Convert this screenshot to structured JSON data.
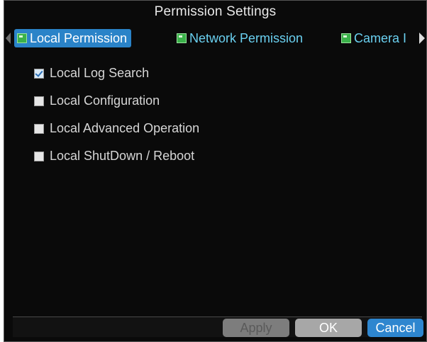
{
  "dialog": {
    "title": "Permission Settings"
  },
  "tabs": [
    {
      "label": "Local Permission",
      "active": true
    },
    {
      "label": "Network Permission",
      "active": false
    },
    {
      "label": "Camera I",
      "active": false
    }
  ],
  "permissions": [
    {
      "label": "Local Log Search",
      "checked": true
    },
    {
      "label": "Local Configuration",
      "checked": false
    },
    {
      "label": "Local Advanced Operation",
      "checked": false
    },
    {
      "label": "Local ShutDown / Reboot",
      "checked": false
    }
  ],
  "buttons": {
    "apply": "Apply",
    "ok": "OK",
    "cancel": "Cancel"
  },
  "colors": {
    "accent": "#2a83c8",
    "tab_text": "#6ad0f0",
    "background": "#0a0a0a"
  }
}
